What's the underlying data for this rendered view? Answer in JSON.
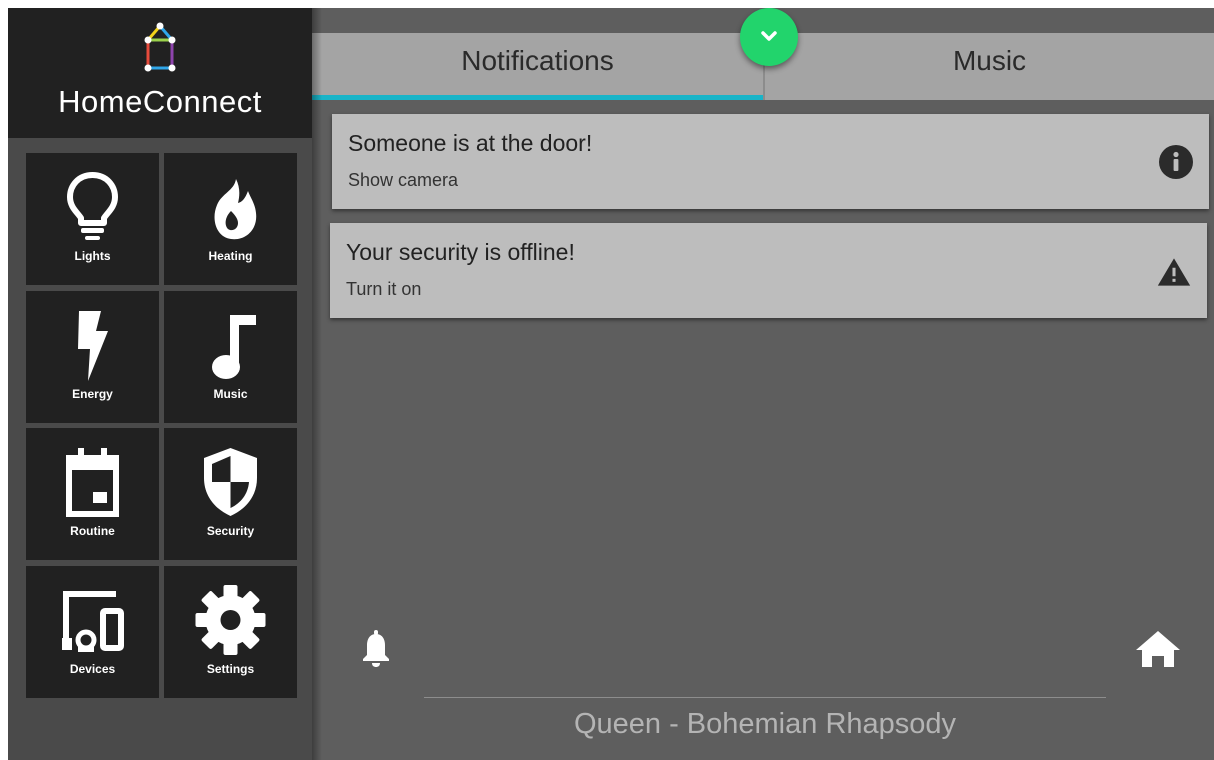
{
  "app": {
    "name": "HomeConnect"
  },
  "sidebar": {
    "tiles": [
      {
        "label": "Lights",
        "icon": "lightbulb-icon"
      },
      {
        "label": "Heating",
        "icon": "flame-icon"
      },
      {
        "label": "Energy",
        "icon": "lightning-bolt-icon"
      },
      {
        "label": "Music",
        "icon": "music-note-icon"
      },
      {
        "label": "Routine",
        "icon": "calendar-icon"
      },
      {
        "label": "Security",
        "icon": "shield-icon"
      },
      {
        "label": "Devices",
        "icon": "devices-icon"
      },
      {
        "label": "Settings",
        "icon": "gear-icon"
      }
    ]
  },
  "tabs": [
    {
      "label": "Notifications",
      "active": true
    },
    {
      "label": "Music",
      "active": false
    }
  ],
  "fab": {
    "icon": "chevron-down-icon"
  },
  "notifications": [
    {
      "title": "Someone is at the door!",
      "subtitle": "Show camera",
      "icon": "info-icon"
    },
    {
      "title": "Your security is offline!",
      "subtitle": "Turn it on",
      "icon": "warning-icon"
    }
  ],
  "bottom_bar": {
    "left_icon": "bell-icon",
    "right_icon": "home-icon",
    "now_playing": "Queen - Bohemian Rhapsody"
  },
  "colors": {
    "accent_tab_indicator": "#18b4c8",
    "fab_green": "#22d46c",
    "tile_background": "#212121",
    "card_background": "#bdbdbd",
    "main_background": "#5e5e5e"
  }
}
